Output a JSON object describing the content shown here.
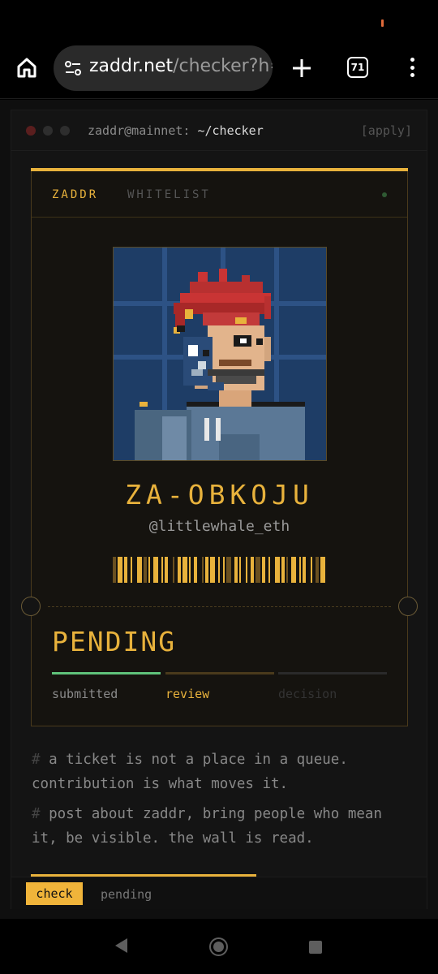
{
  "browser": {
    "url_host": "zaddr.net",
    "url_path": "/checker?h=l",
    "tab_count": "71"
  },
  "terminal": {
    "prompt_user": "zaddr@mainnet:",
    "prompt_path": "~/checker",
    "action": "[apply]",
    "dot_colors": [
      "#5a1e1e",
      "#2e2e2e",
      "#2e2e2e"
    ]
  },
  "card": {
    "brand": "ZADDR",
    "label": "WHITELIST",
    "name": "ZA-OBKOJU",
    "handle": "@littlewhale_eth",
    "status": "PENDING",
    "steps": [
      {
        "label": "submitted",
        "state": "done",
        "color": "#5fc27a",
        "label_color": "#8a8a8a"
      },
      {
        "label": "review",
        "state": "active",
        "color": "#4a3a1c",
        "label_color": "#e8b23c"
      },
      {
        "label": "decision",
        "state": "upcoming",
        "color": "#2a2a2a",
        "label_color": "#333"
      }
    ]
  },
  "notes": [
    "a ticket is not a place in a queue. contribution is what moves it.",
    "post about zaddr, bring people who mean it, be visible. the wall is read."
  ],
  "note_prefix": "#",
  "tabs": {
    "check": "check",
    "pending": "pending"
  },
  "colors": {
    "accent": "#e8b23c",
    "success": "#5fc27a",
    "background": "#141414"
  }
}
